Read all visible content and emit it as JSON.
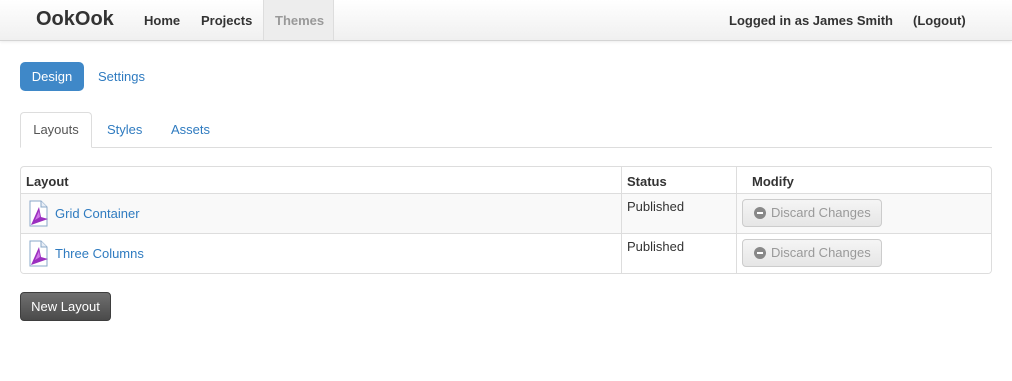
{
  "navbar": {
    "brand": "OokOok",
    "links": [
      "Home",
      "Projects",
      "Themes"
    ],
    "login_text": "Logged in as James Smith",
    "logout_label": "(Logout)"
  },
  "pills": {
    "active": "Design",
    "other": "Settings"
  },
  "tabs": [
    "Layouts",
    "Styles",
    "Assets"
  ],
  "table": {
    "headers": [
      "Layout",
      "Status",
      "Modify"
    ],
    "rows": [
      {
        "name": "Grid Container",
        "status": "Published",
        "action": "Discard Changes"
      },
      {
        "name": "Three Columns",
        "status": "Published",
        "action": "Discard Changes"
      }
    ]
  },
  "new_layout_label": "New Layout",
  "colors": {
    "accent": "#3f88c8",
    "link": "#2f7bc0",
    "icon_purple": "#9b2fc0"
  },
  "icons": [
    "layout-file-icon",
    "minus-circle-icon"
  ]
}
